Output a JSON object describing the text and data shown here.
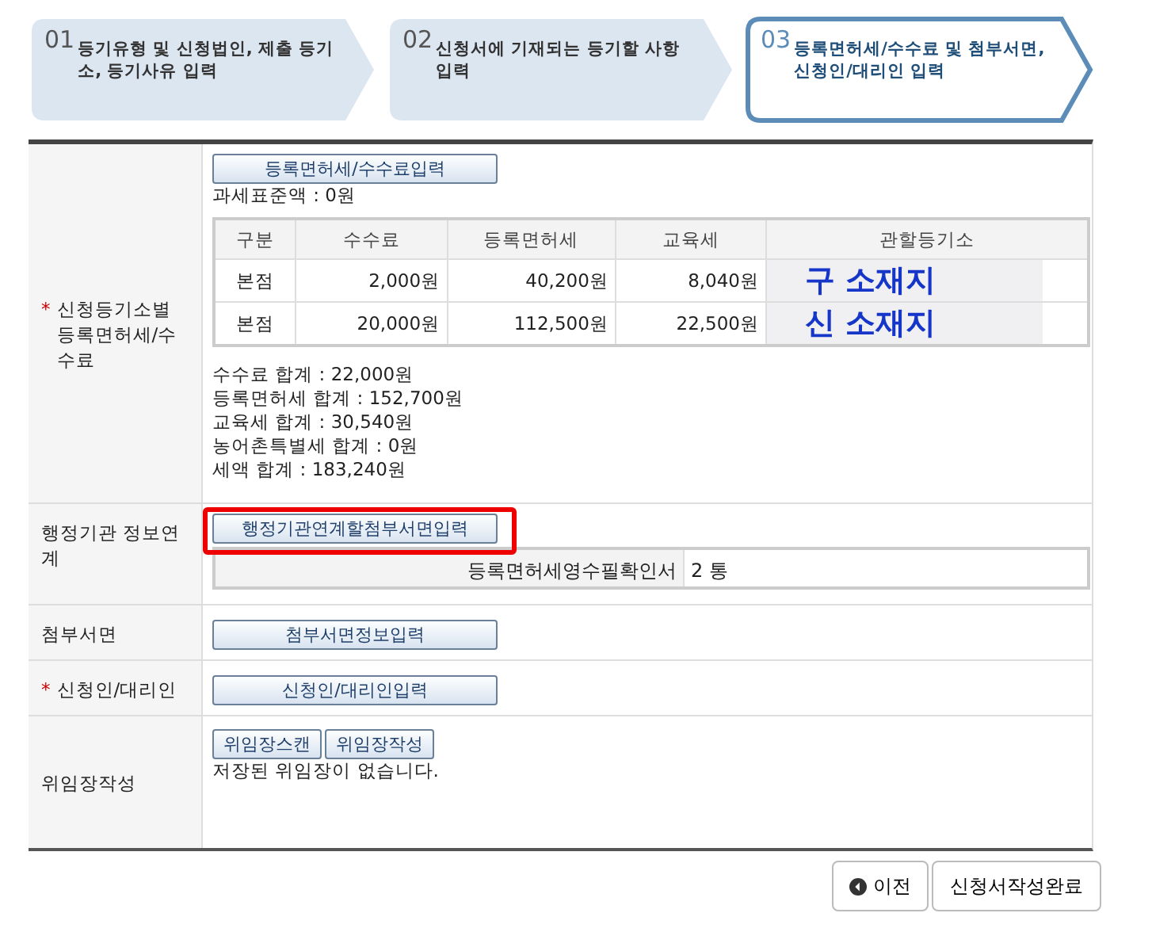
{
  "steps": [
    {
      "number": "01",
      "label": "등기유형 및 신청법인, 제출 등기소, 등기사유 입력",
      "selected": false
    },
    {
      "number": "02",
      "label": "신청서에 기재되는 등기할 사항 입력",
      "selected": false
    },
    {
      "number": "03",
      "label": "등록면허세/수수료 및 첨부서면, 신청인/대리인 입력",
      "selected": true
    }
  ],
  "fees": {
    "mark": "*",
    "label": "신청등기소별 등록면허세/수수료",
    "button": "등록면허세/수수료입력",
    "tax_base": "과세표준액 : 0원",
    "columns": [
      "구분",
      "수수료",
      "등록면허세",
      "교육세",
      "관할등기소"
    ],
    "rows": [
      {
        "type": "본점",
        "fee": "2,000원",
        "license_tax": "40,200원",
        "edu_tax": "8,040원",
        "office": "구 소재지"
      },
      {
        "type": "본점",
        "fee": "20,000원",
        "license_tax": "112,500원",
        "edu_tax": "22,500원",
        "office": "신 소재지"
      }
    ],
    "totals": [
      "수수료 합계 : 22,000원",
      "등록면허세 합계 : 152,700원",
      "교육세 합계 : 30,540원",
      "농어촌특별세 합계 : 0원",
      "세액 합계 : 183,240원"
    ]
  },
  "agency": {
    "label": "행정기관 정보연계",
    "button": "행정기관연계할첨부서면입력",
    "highlighted": true,
    "doc_label": "등록면허세영수필확인서",
    "doc_count": "2 통"
  },
  "attachments": {
    "label": "첨부서면",
    "button": "첨부서면정보입력"
  },
  "applicant": {
    "mark": "*",
    "label": "신청인/대리인",
    "button": "신청인/대리인입력"
  },
  "proxy": {
    "label": "위임장작성",
    "buttons": [
      "위임장스캔",
      "위임장작성"
    ],
    "message": "저장된 위임장이 없습니다."
  },
  "footer": {
    "prev": "이전",
    "complete": "신청서작성완료"
  }
}
